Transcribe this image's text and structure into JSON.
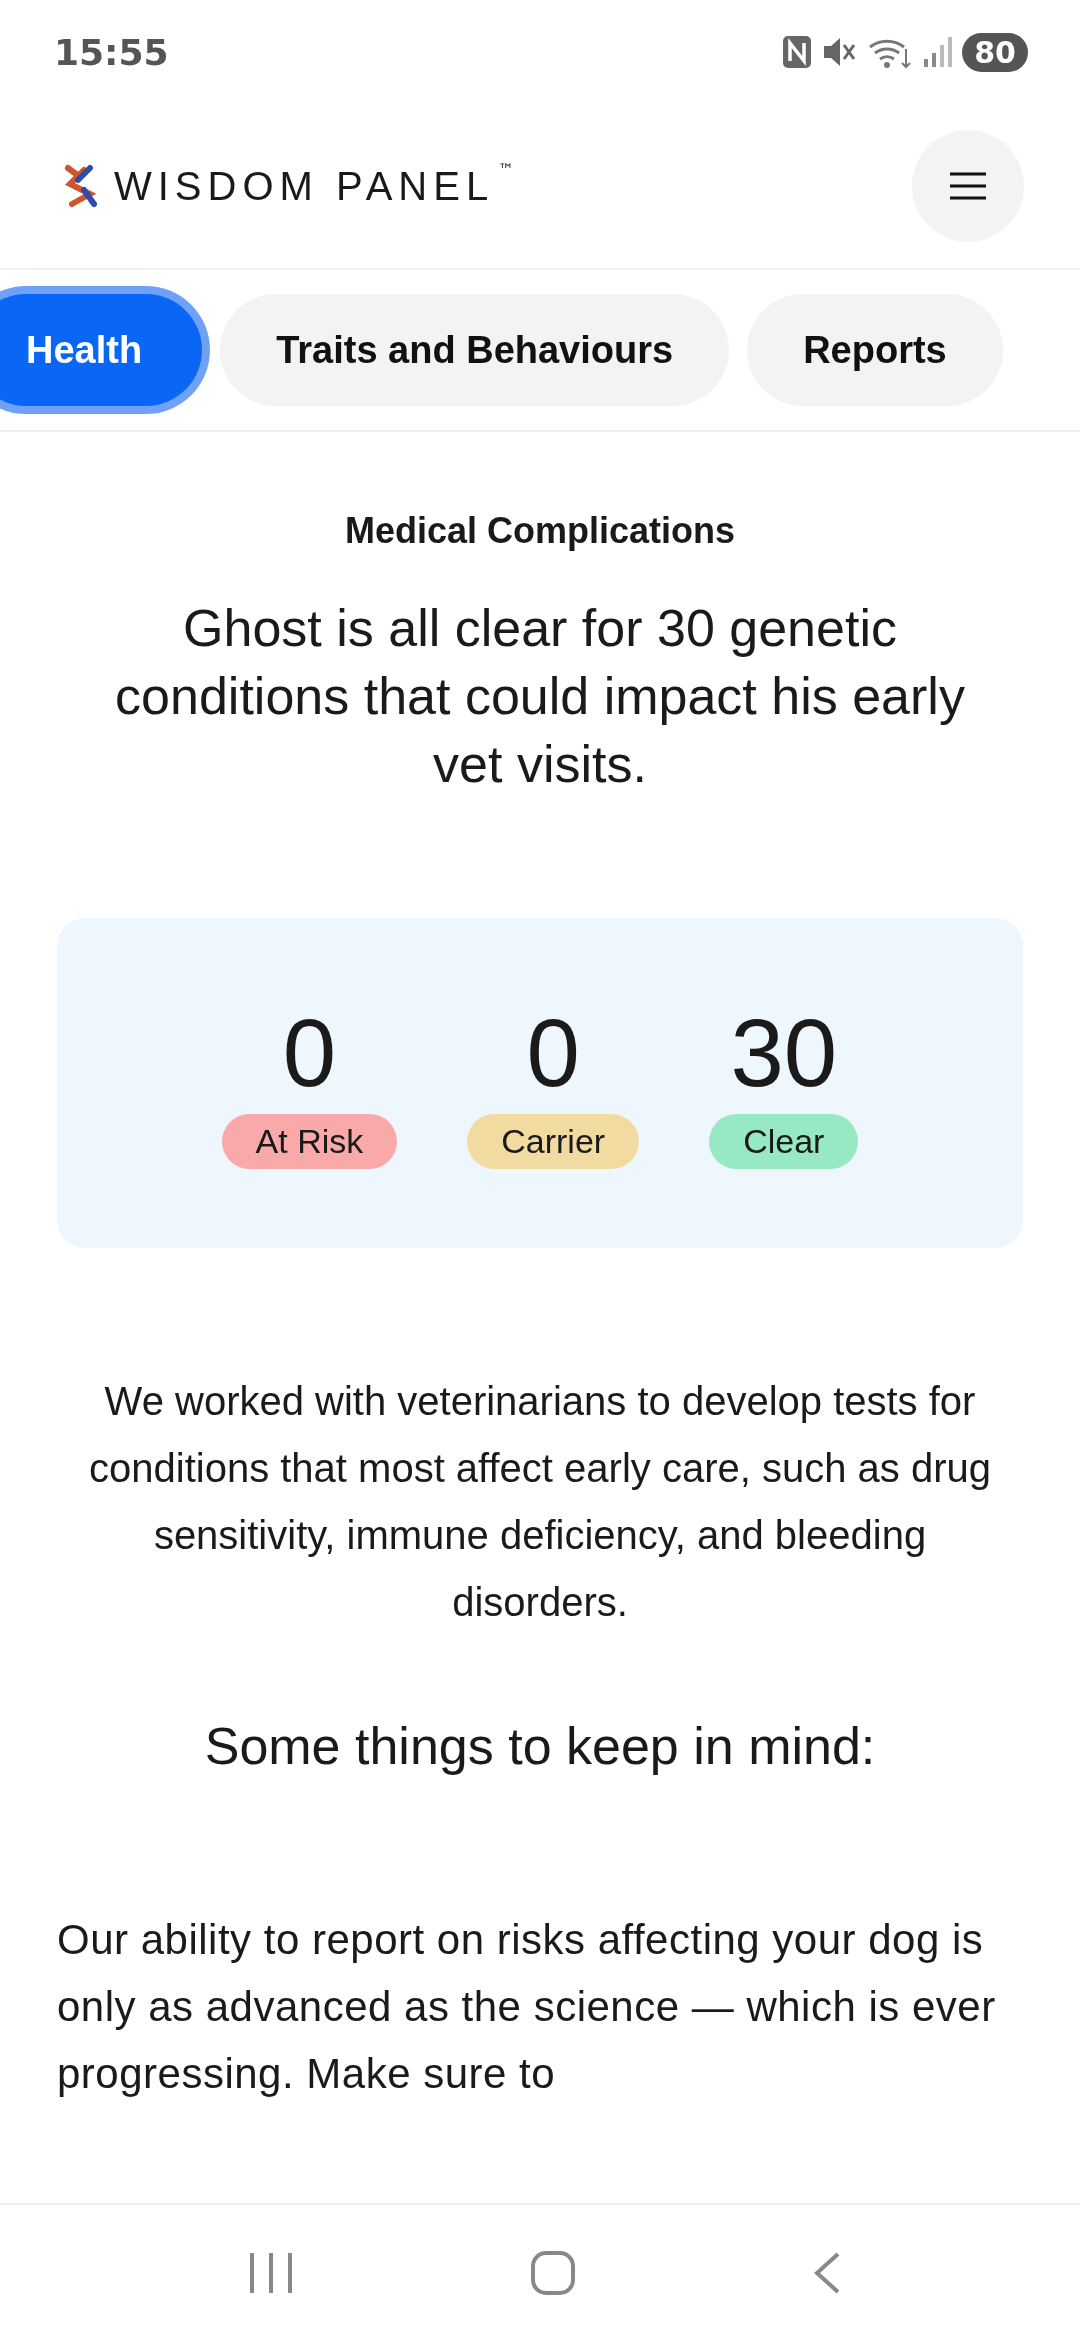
{
  "status_bar": {
    "time": "15:55",
    "battery": "80"
  },
  "header": {
    "brand": "WISDOM PANEL",
    "trademark": "™"
  },
  "tabs": [
    {
      "label": "Health",
      "selected": true
    },
    {
      "label": "Traits and Behaviours",
      "selected": false
    },
    {
      "label": "Reports",
      "selected": false
    }
  ],
  "section_label": "Medical Complications",
  "headline": "Ghost is all clear for 30 genetic conditions that could impact his early vet visits.",
  "stats": [
    {
      "count": "0",
      "label": "At Risk",
      "color": "#f9a9a9"
    },
    {
      "count": "0",
      "label": "Carrier",
      "color": "#f2dba1"
    },
    {
      "count": "30",
      "label": "Clear",
      "color": "#96e9c2"
    }
  ],
  "intro": "We worked with veterinarians to develop tests for conditions that most affect early care, such as drug sensitivity, immune deficiency, and bleeding disorders.",
  "subheading": "Some things to keep in mind:",
  "body": "Our ability to report on risks affecting your dog is only as advanced as the science — which is ever progressing. Make sure to"
}
